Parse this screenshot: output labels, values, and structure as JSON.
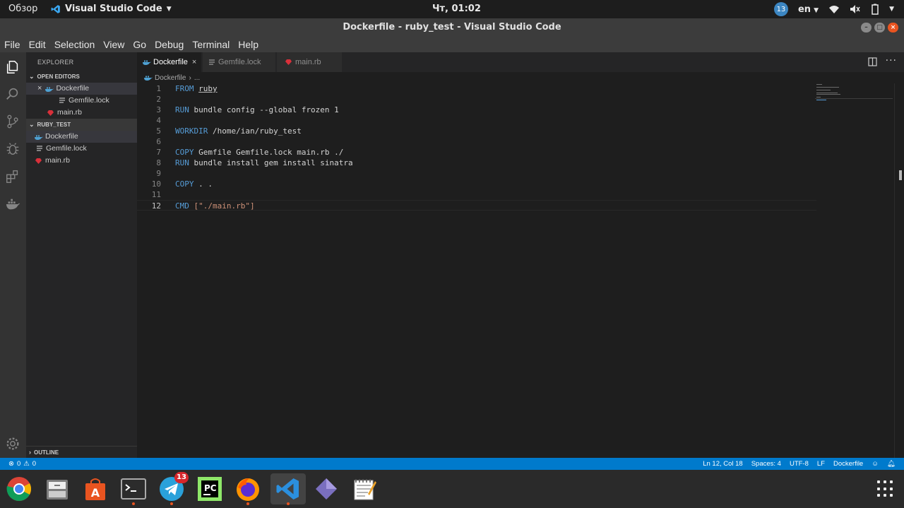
{
  "topbar": {
    "overview": "Обзор",
    "app_name": "Visual Studio Code",
    "clock": "Чт, 01:02",
    "notification_count": "13",
    "language": "en"
  },
  "window": {
    "title": "Dockerfile - ruby_test - Visual Studio Code"
  },
  "menu": [
    "File",
    "Edit",
    "Selection",
    "View",
    "Go",
    "Debug",
    "Terminal",
    "Help"
  ],
  "sidebar": {
    "title": "EXPLORER",
    "open_editors_header": "OPEN EDITORS",
    "open_editors": [
      "Dockerfile",
      "Gemfile.lock",
      "main.rb"
    ],
    "folder_header": "RUBY_TEST",
    "files": [
      "Dockerfile",
      "Gemfile.lock",
      "main.rb"
    ],
    "outline_header": "OUTLINE"
  },
  "tabs": [
    "Dockerfile",
    "Gemfile.lock",
    "main.rb"
  ],
  "breadcrumb": {
    "file": "Dockerfile",
    "more": "..."
  },
  "editor": {
    "lines": [
      {
        "num": "1",
        "kw": "FROM",
        "rest": "ruby"
      },
      {
        "num": "2",
        "kw": "",
        "rest": ""
      },
      {
        "num": "3",
        "kw": "RUN",
        "rest": " bundle config --global frozen 1"
      },
      {
        "num": "4",
        "kw": "",
        "rest": ""
      },
      {
        "num": "5",
        "kw": "WORKDIR",
        "rest": " /home/ian/ruby_test"
      },
      {
        "num": "6",
        "kw": "",
        "rest": ""
      },
      {
        "num": "7",
        "kw": "COPY",
        "rest": " Gemfile Gemfile.lock main.rb ./"
      },
      {
        "num": "8",
        "kw": "RUN",
        "rest": " bundle install gem install sinatra"
      },
      {
        "num": "9",
        "kw": "",
        "rest": ""
      },
      {
        "num": "10",
        "kw": "COPY",
        "rest": " . ."
      },
      {
        "num": "11",
        "kw": "",
        "rest": ""
      },
      {
        "num": "12",
        "kw": "CMD",
        "rest": "[\"./main.rb\"]"
      }
    ]
  },
  "statusbar": {
    "errors": "0",
    "warnings": "0",
    "position": "Ln 12, Col 18",
    "spaces": "Spaces: 4",
    "encoding": "UTF-8",
    "eol": "LF",
    "language": "Dockerfile"
  },
  "dock": {
    "telegram_badge": "13",
    "pycharm_label": "PC"
  },
  "colors": {
    "accent": "#007acc",
    "keyword": "#569cd6",
    "string": "#ce9178",
    "ubuntu_orange": "#e95420"
  }
}
